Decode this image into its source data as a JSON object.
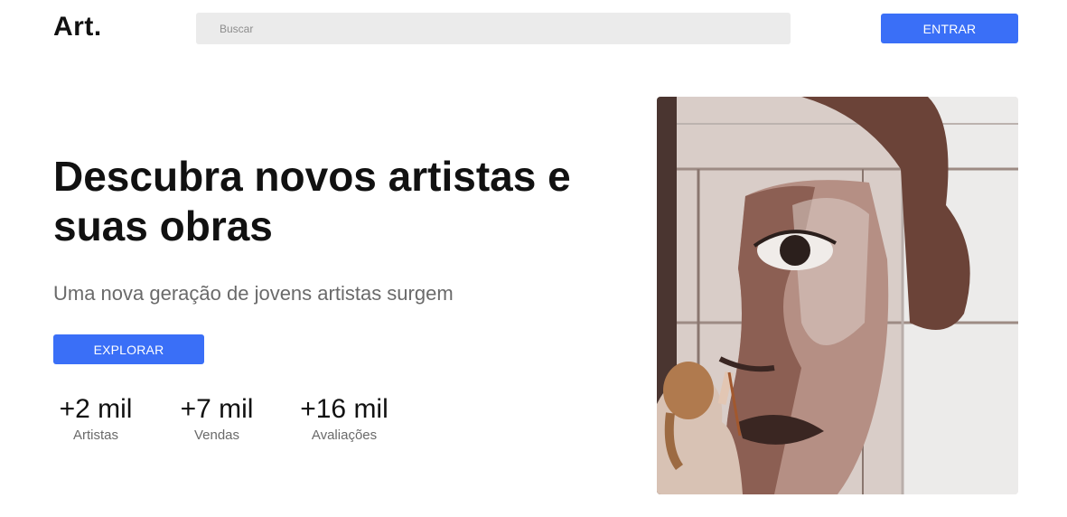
{
  "header": {
    "logo": "Art.",
    "search_placeholder": "Buscar",
    "enter_label": "ENTRAR"
  },
  "hero": {
    "headline": "Descubra novos artistas e suas obras",
    "subtitle": "Uma nova geração de jovens artistas surgem",
    "explore_label": "EXPLORAR",
    "image_alt": "mural-painting-photo"
  },
  "stats": [
    {
      "value": "+2 mil",
      "label": "Artistas"
    },
    {
      "value": "+7 mil",
      "label": "Vendas"
    },
    {
      "value": "+16 mil",
      "label": "Avaliações"
    }
  ],
  "colors": {
    "accent": "#3a6ff7",
    "search_bg": "#ebebeb",
    "muted_text": "#6a6a6a"
  }
}
